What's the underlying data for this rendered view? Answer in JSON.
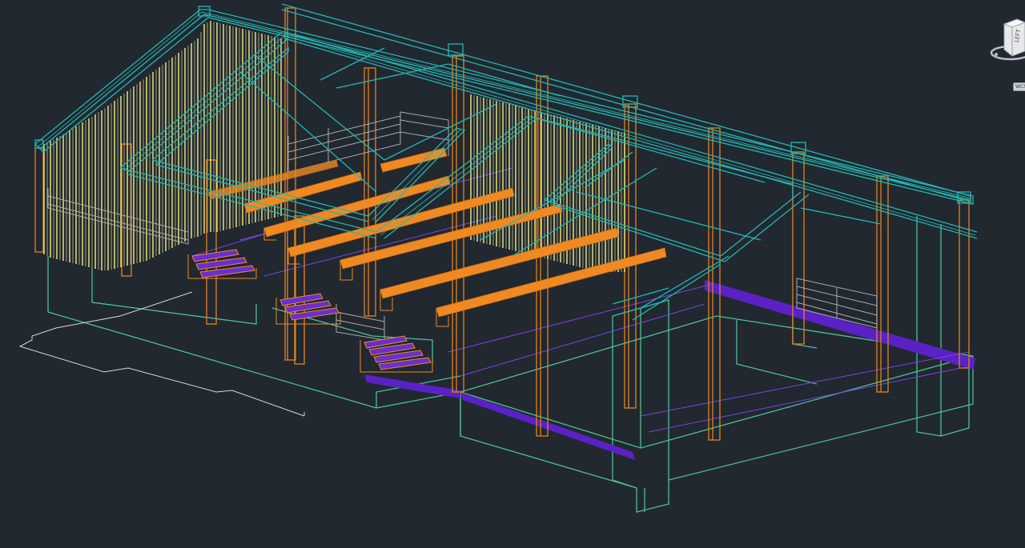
{
  "viewport": {
    "background": "#212830",
    "style": "3D wireframe",
    "layer_colors": {
      "roof_beams": "#1fb8b4",
      "columns": "#e8811a",
      "cladding_slats": "#e6e07a",
      "walkway_panels": "#ef8a22",
      "stair_and_edge_beams": "#6a2fd0",
      "railings": "#a9abb0",
      "ground_slab": "#4fbf8f",
      "site_outline": "#d8d8d8"
    }
  },
  "viewcube": {
    "face_label": "LEFT",
    "icon": "viewcube-icon"
  },
  "wcs_menu": {
    "label": "WCS"
  }
}
